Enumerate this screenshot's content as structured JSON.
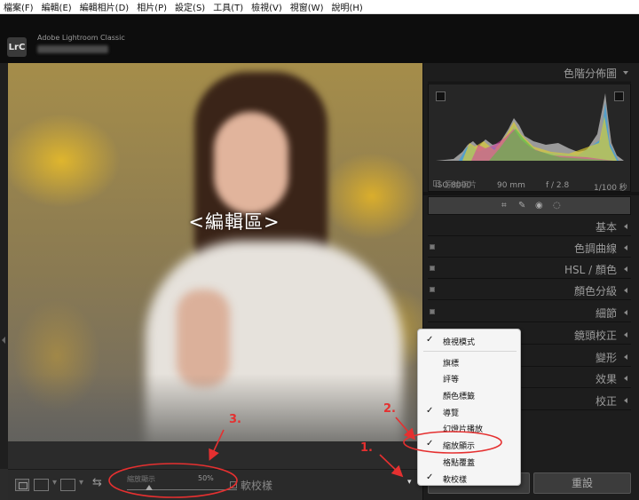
{
  "menubar": {
    "items": [
      "檔案(F)",
      "編輯(E)",
      "編輯相片(D)",
      "相片(P)",
      "設定(S)",
      "工具(T)",
      "檢視(V)",
      "視窗(W)",
      "說明(H)"
    ]
  },
  "titlebar": {
    "logo": "LrC",
    "app_name": "Adobe Lightroom Classic"
  },
  "photo": {
    "overlay_label": "<編輯區>"
  },
  "toolbar": {
    "zoom_label": "縮放顯示",
    "zoom_value": "50%",
    "zoom_fraction": 0.2,
    "softproof_label": "軟校樣"
  },
  "histogram": {
    "title": "色階分佈圖",
    "iso": "ISO 8000",
    "focal": "90 mm",
    "aperture": "f / 2.8",
    "shutter": "1/100 秒",
    "original_label": "原始相片"
  },
  "panels": [
    {
      "label": "基本"
    },
    {
      "label": "色調曲線"
    },
    {
      "label": "HSL / 顏色"
    },
    {
      "label": "顏色分級"
    },
    {
      "label": "細節"
    },
    {
      "label": "鏡頭校正"
    },
    {
      "label": "變形"
    },
    {
      "label": "效果"
    },
    {
      "label": "校正"
    }
  ],
  "buttons": {
    "reset": "重設"
  },
  "context_menu": {
    "items": [
      {
        "label": "檢視模式",
        "checked": true
      },
      {
        "label": "旗標",
        "checked": false
      },
      {
        "label": "評等",
        "checked": false
      },
      {
        "label": "顏色標籤",
        "checked": false
      },
      {
        "label": "導覽",
        "checked": true
      },
      {
        "label": "幻燈片播放",
        "checked": false
      },
      {
        "label": "縮放顯示",
        "checked": true
      },
      {
        "label": "格點覆蓋",
        "checked": false
      },
      {
        "label": "軟校樣",
        "checked": true
      }
    ],
    "check_glyph": "✓"
  },
  "annotations": {
    "one": "1.",
    "two": "2.",
    "three": "3.",
    "color": "#e53030"
  }
}
